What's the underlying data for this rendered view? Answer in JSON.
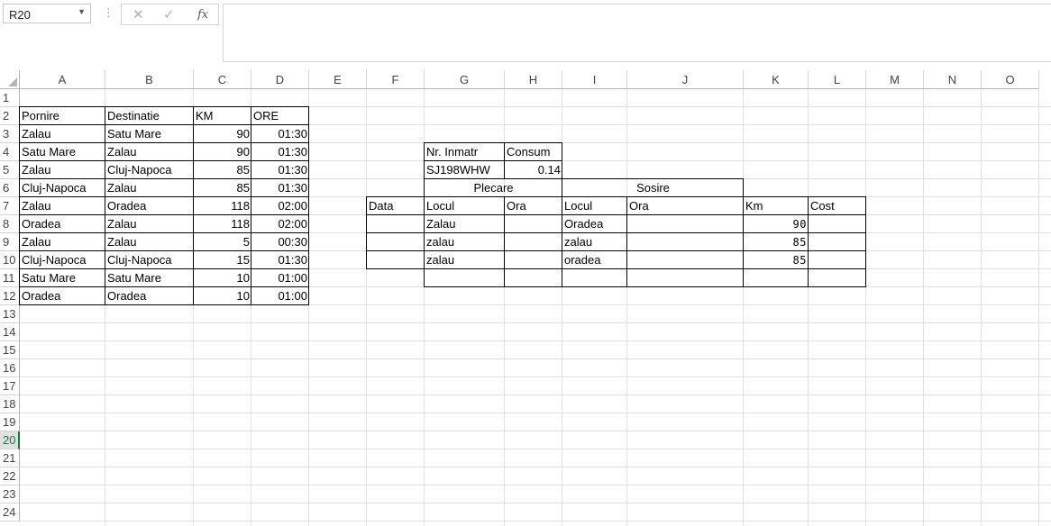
{
  "formula_bar": {
    "name_box": "R20",
    "cancel_glyph": "✕",
    "confirm_glyph": "✓",
    "function_glyph": "fx",
    "formula_value": ""
  },
  "columns": [
    "A",
    "B",
    "C",
    "D",
    "E",
    "F",
    "G",
    "H",
    "I",
    "J",
    "K",
    "L",
    "M",
    "N",
    "O"
  ],
  "rows": [
    "1",
    "2",
    "3",
    "4",
    "5",
    "6",
    "7",
    "8",
    "9",
    "10",
    "11",
    "12",
    "13",
    "14",
    "15",
    "16",
    "17",
    "18",
    "19",
    "20",
    "21",
    "22",
    "23",
    "24"
  ],
  "active_row": "20",
  "route_table": {
    "headers": [
      "Pornire",
      "Destinatie",
      "KM",
      "ORE"
    ],
    "rows": [
      [
        "Zalau",
        "Satu Mare",
        "90",
        "01:30"
      ],
      [
        "Satu Mare",
        "Zalau",
        "90",
        "01:30"
      ],
      [
        "Zalau",
        "Cluj-Napoca",
        "85",
        "01:30"
      ],
      [
        "Cluj-Napoca",
        "Zalau",
        "85",
        "01:30"
      ],
      [
        "Zalau",
        "Oradea",
        "118",
        "02:00"
      ],
      [
        "Oradea",
        "Zalau",
        "118",
        "02:00"
      ],
      [
        "Zalau",
        "Zalau",
        "5",
        "00:30"
      ],
      [
        "Cluj-Napoca",
        "Cluj-Napoca",
        "15",
        "01:30"
      ],
      [
        "Satu Mare",
        "Satu Mare",
        "10",
        "01:00"
      ],
      [
        "Oradea",
        "Oradea",
        "10",
        "01:00"
      ]
    ]
  },
  "vehicle_table": {
    "headers": [
      "Nr. Inmatr",
      "Consum"
    ],
    "plate": "SJ198WHW",
    "consumption": "0.14"
  },
  "trip_table": {
    "group_departure": "Plecare",
    "group_arrival": "Sosire",
    "headers": [
      "Data",
      "Locul",
      "Ora",
      "Locul",
      "Ora",
      "Km",
      "Cost"
    ],
    "rows": [
      [
        "",
        "Zalau",
        "",
        "Oradea",
        "",
        "90",
        ""
      ],
      [
        "",
        "zalau",
        "",
        "zalau",
        "",
        "85",
        ""
      ],
      [
        "",
        "zalau",
        "",
        "oradea",
        "",
        "85",
        ""
      ],
      [
        "",
        "",
        "",
        "",
        "",
        "",
        ""
      ]
    ]
  }
}
